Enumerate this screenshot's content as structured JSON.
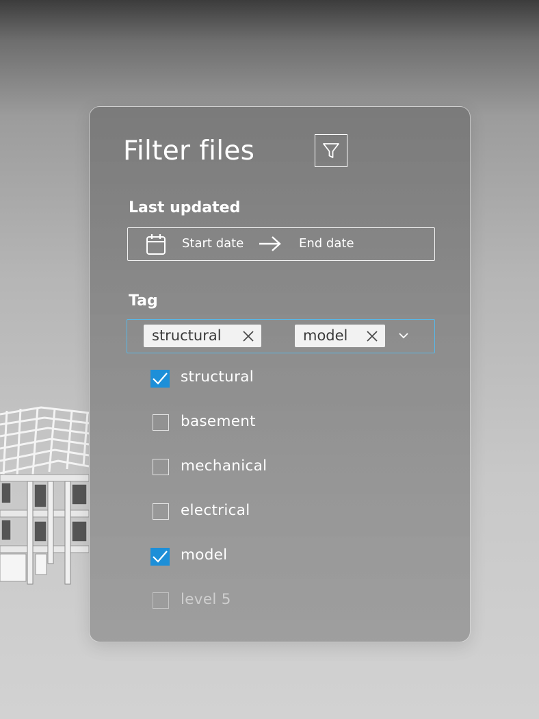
{
  "panel": {
    "title": "Filter files",
    "filter_icon": "funnel-icon"
  },
  "last_updated": {
    "label": "Last updated",
    "calendar_icon": "calendar-icon",
    "start_placeholder": "Start date",
    "arrow_icon": "arrow-right-icon",
    "end_placeholder": "End date"
  },
  "tag": {
    "label": "Tag",
    "chips": [
      {
        "label": "structural",
        "remove_icon": "close-icon"
      },
      {
        "label": "model",
        "remove_icon": "close-icon"
      }
    ],
    "dropdown_icon": "chevron-down-icon",
    "options": [
      {
        "label": "structural",
        "checked": true
      },
      {
        "label": "basement",
        "checked": false
      },
      {
        "label": "mechanical",
        "checked": false
      },
      {
        "label": "electrical",
        "checked": false
      },
      {
        "label": "model",
        "checked": true
      },
      {
        "label": "level 5",
        "checked": false
      }
    ]
  },
  "colors": {
    "accent": "#1d8fd8",
    "focus_border": "#58b8e8",
    "chip_bg": "#f2f2f2"
  }
}
